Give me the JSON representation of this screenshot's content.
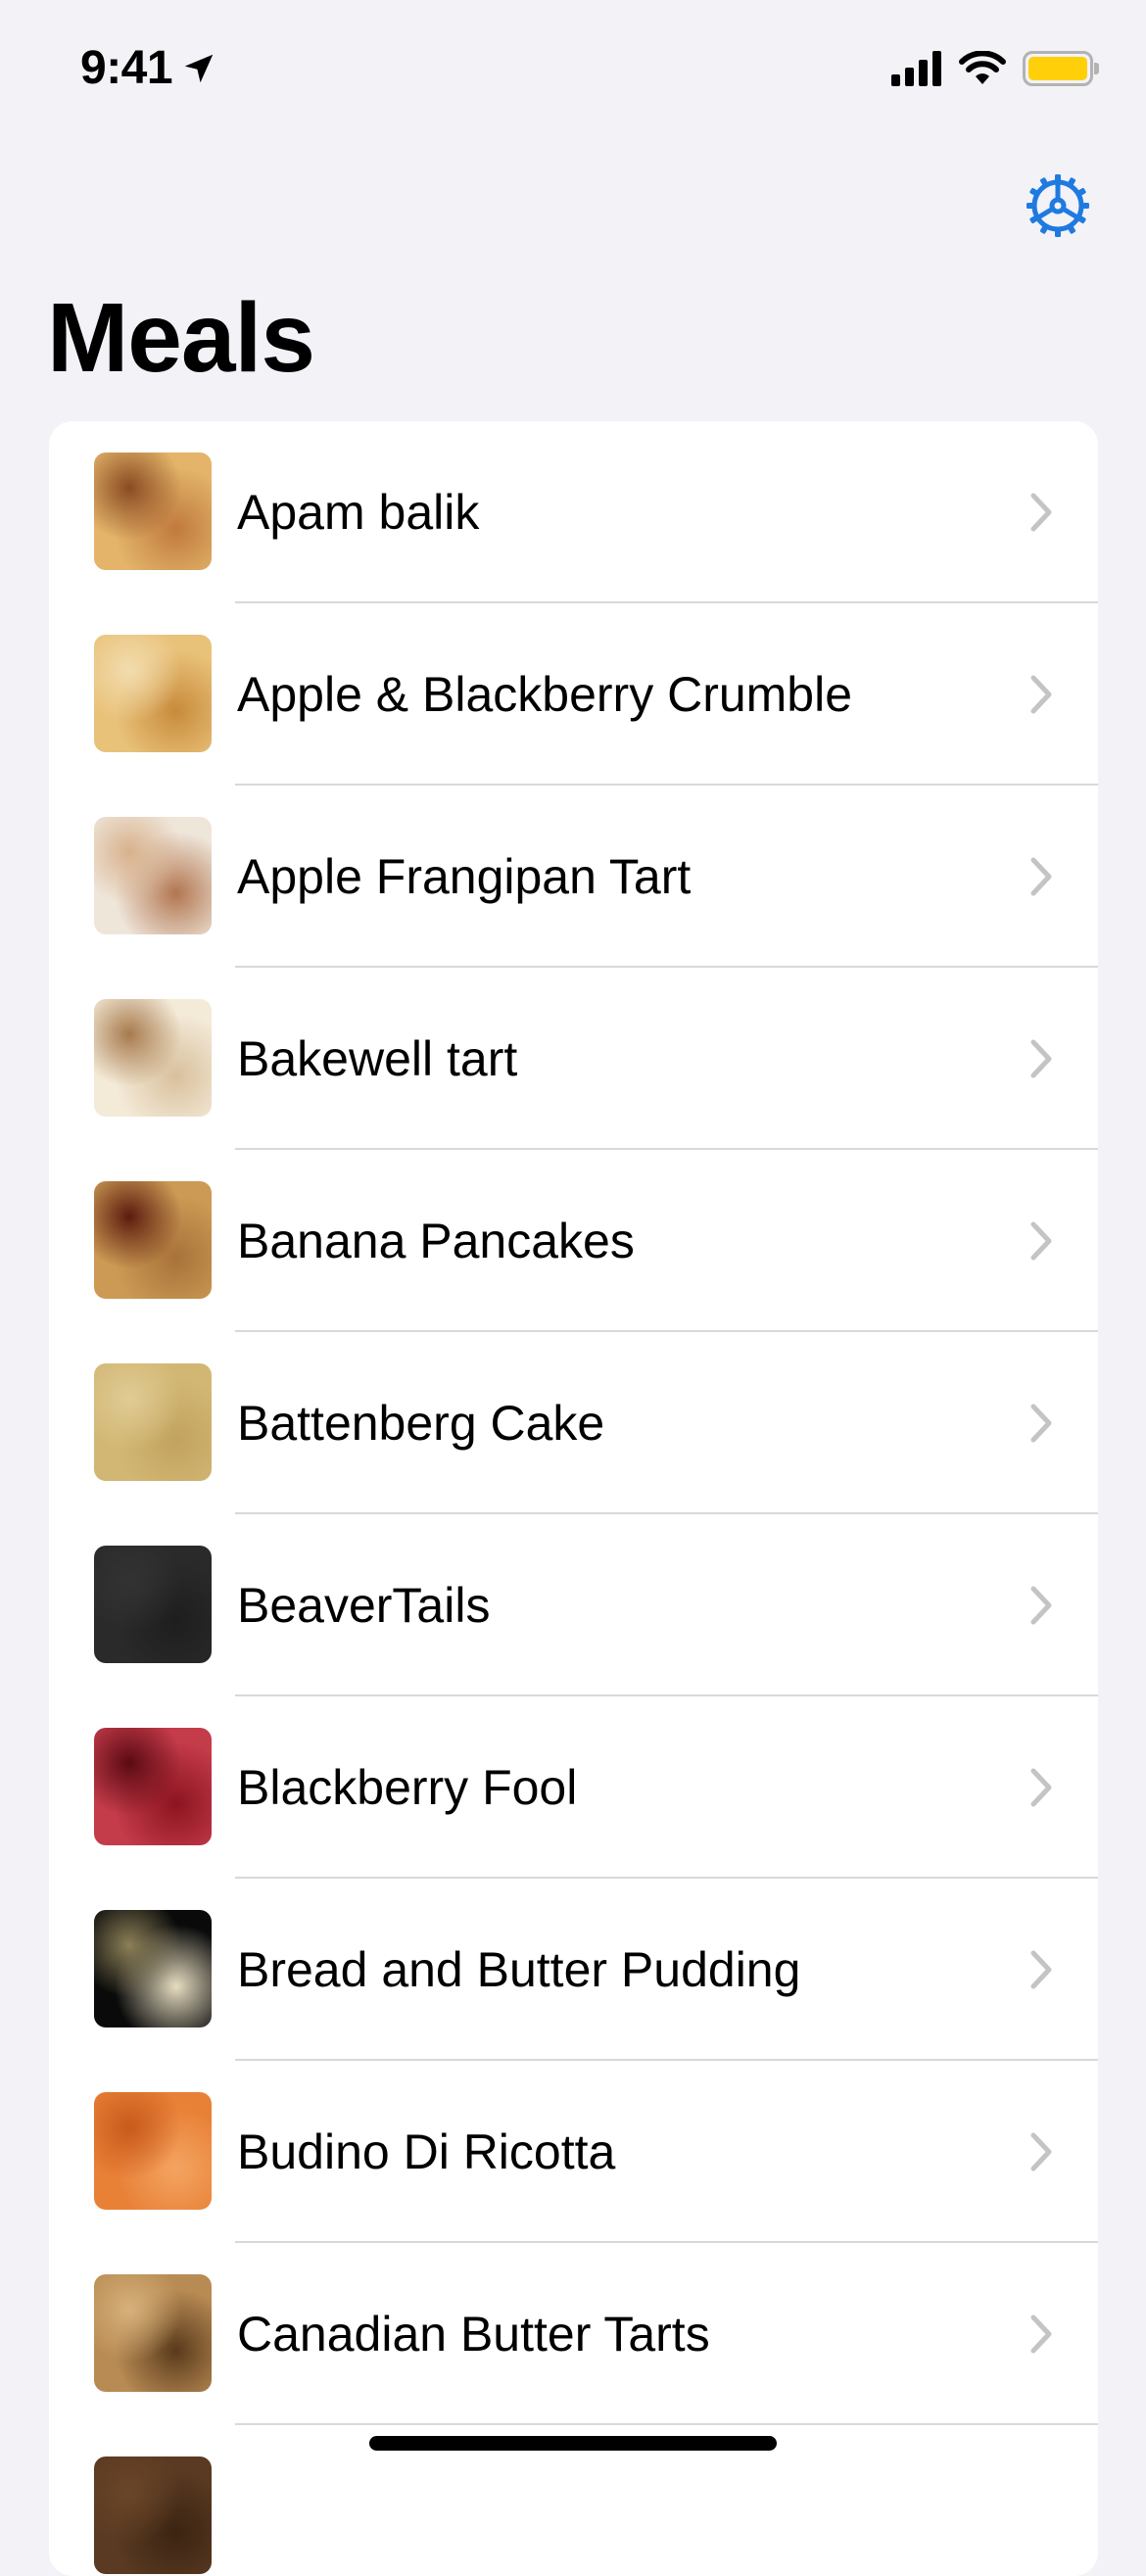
{
  "status_bar": {
    "time": "9:41"
  },
  "nav": {
    "title": "Meals",
    "settings_icon": "gear-icon",
    "accent": "#1f7ae0"
  },
  "meals": [
    {
      "name": "Apam balik",
      "thumb": [
        "#e3b46a",
        "#c07a3d",
        "#8a4a22"
      ]
    },
    {
      "name": "Apple & Blackberry Crumble",
      "thumb": [
        "#e9c27a",
        "#c88b3c",
        "#f2dcae"
      ]
    },
    {
      "name": "Apple Frangipan Tart",
      "thumb": [
        "#efe6da",
        "#b27650",
        "#d8b18c"
      ]
    },
    {
      "name": "Bakewell tart",
      "thumb": [
        "#f4ead8",
        "#d8c09c",
        "#a77a4c"
      ]
    },
    {
      "name": "Banana Pancakes",
      "thumb": [
        "#cc9a54",
        "#a8723a",
        "#5c1b0e"
      ]
    },
    {
      "name": "Battenberg Cake",
      "thumb": [
        "#d2b774",
        "#c2a35f",
        "#e0cb94"
      ]
    },
    {
      "name": "BeaverTails",
      "thumb": [
        "#2a2a2a",
        "#1e1e1e",
        "#333333"
      ]
    },
    {
      "name": "Blackberry Fool",
      "thumb": [
        "#c43b4a",
        "#8c1420",
        "#5a0a12"
      ]
    },
    {
      "name": "Bread and Butter Pudding",
      "thumb": [
        "#0a0a0a",
        "#e6dcc0",
        "#8c8058"
      ]
    },
    {
      "name": "Budino Di Ricotta",
      "thumb": [
        "#e88036",
        "#f4a461",
        "#c85a1c"
      ]
    },
    {
      "name": "Canadian Butter Tarts",
      "thumb": [
        "#b98b54",
        "#5a3a1c",
        "#d6b07a"
      ]
    },
    {
      "name": "",
      "thumb": [
        "#5a3a22",
        "#3a2412",
        "#6a4528"
      ]
    }
  ]
}
